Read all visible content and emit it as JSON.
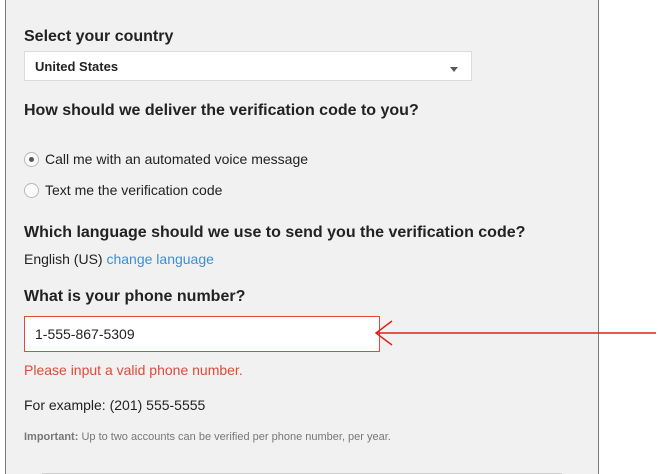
{
  "country": {
    "heading": "Select your country",
    "selected": "United States"
  },
  "delivery": {
    "heading": "How should we deliver the verification code to you?",
    "options": [
      {
        "label": "Call me with an automated voice message",
        "checked": true
      },
      {
        "label": "Text me the verification code",
        "checked": false
      }
    ]
  },
  "language": {
    "heading": "Which language should we use to send you the verification code?",
    "current": "English (US)",
    "change_link": "change language"
  },
  "phone": {
    "heading": "What is your phone number?",
    "value": "1-555-867-5309",
    "error": "Please input a valid phone number.",
    "example": "For example: (201) 555-5555"
  },
  "note": {
    "prefix": "Important:",
    "text": "Up to two accounts can be verified per phone number, per year."
  },
  "colors": {
    "error": "#dd4b39",
    "link": "#3a8fd8",
    "annotation_arrow": "#e0201b"
  }
}
